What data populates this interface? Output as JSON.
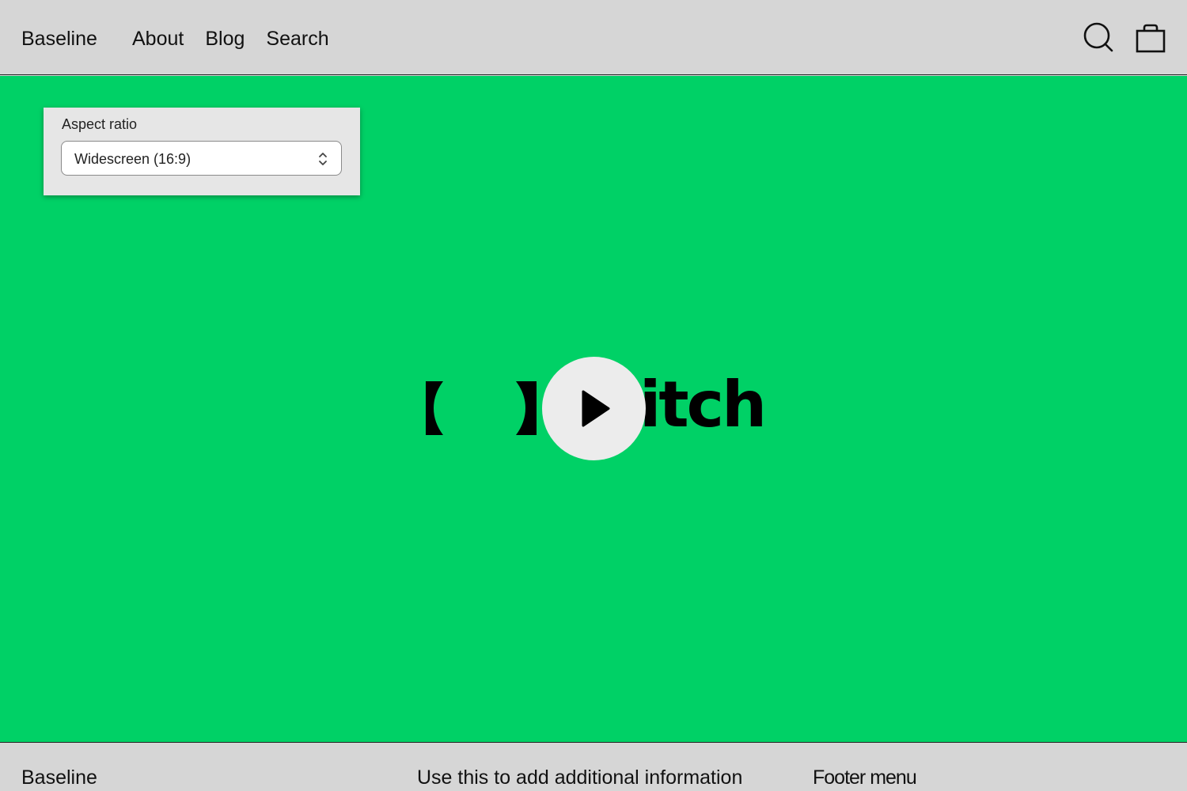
{
  "header": {
    "brand": "Baseline",
    "nav": [
      "About",
      "Blog",
      "Search"
    ],
    "search_icon": "search-icon",
    "cart_icon": "shopping-bag-icon"
  },
  "hero": {
    "background_color": "#00d166",
    "logo_text": "itch",
    "play_icon": "play-icon"
  },
  "aspect_ratio_control": {
    "label": "Aspect ratio",
    "selected": "Widescreen (16:9)"
  },
  "footer": {
    "brand": "Baseline",
    "info": "Use this to add additional information",
    "menu_heading": "Footer menu"
  }
}
